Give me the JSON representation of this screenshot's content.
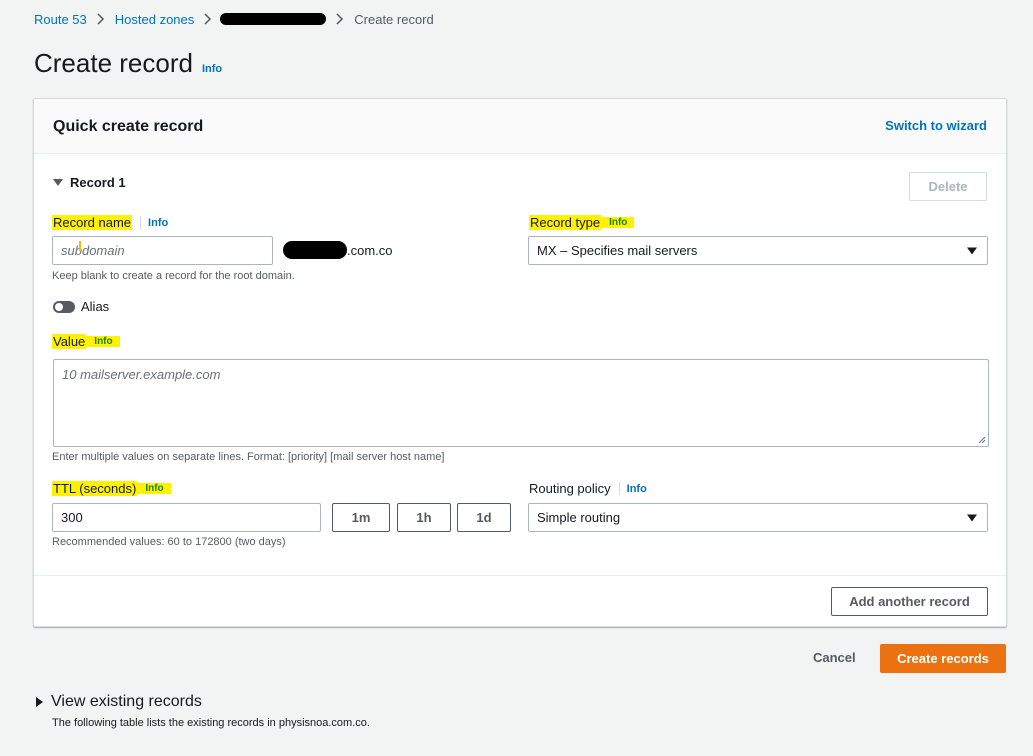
{
  "breadcrumb": {
    "route53": "Route 53",
    "hosted_zones": "Hosted zones",
    "current": "Create record"
  },
  "page": {
    "title": "Create record",
    "info": "Info"
  },
  "panel": {
    "title": "Quick create record",
    "switch_wizard": "Switch to wizard"
  },
  "record": {
    "toggle_label": "Record 1",
    "delete_label": "Delete",
    "name_label": "Record name",
    "name_info": "Info",
    "name_placeholder": "subdomain",
    "domain_suffix": ".com.co",
    "name_hint": "Keep blank to create a record for the root domain.",
    "type_label": "Record type",
    "type_info": "Info",
    "type_value": "MX – Specifies mail servers",
    "alias_label": "Alias",
    "value_label": "Value",
    "value_info": "Info",
    "value_placeholder": "10 mailserver.example.com",
    "value_hint": "Enter multiple values on separate lines. Format: [priority] [mail server host name]",
    "ttl_label": "TTL (seconds)",
    "ttl_info": "Info",
    "ttl_value": "300",
    "ttl_1m": "1m",
    "ttl_1h": "1h",
    "ttl_1d": "1d",
    "ttl_hint": "Recommended values: 60 to 172800 (two days)",
    "routing_label": "Routing policy",
    "routing_info": "Info",
    "routing_value": "Simple routing",
    "add_another": "Add another record"
  },
  "actions": {
    "cancel": "Cancel",
    "create": "Create records"
  },
  "existing": {
    "title": "View existing records",
    "description": "The following table lists the existing records in physisnoa.com.co."
  },
  "colors": {
    "link": "#0073bb",
    "primary": "#ec7211",
    "highlight": "#fff200"
  }
}
